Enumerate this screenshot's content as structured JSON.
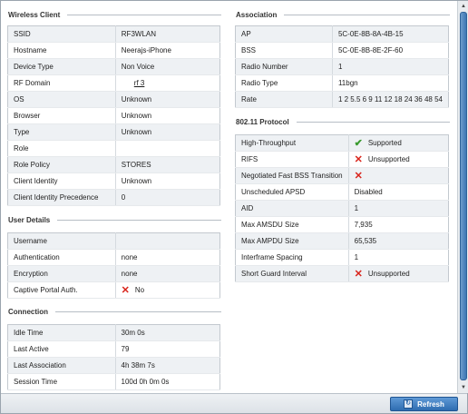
{
  "wireless_client": {
    "title": "Wireless Client",
    "rows": [
      {
        "k": "SSID",
        "v": "RF3WLAN"
      },
      {
        "k": "Hostname",
        "v": "Neerajs-iPhone"
      },
      {
        "k": "Device Type",
        "v": "Non Voice"
      },
      {
        "k": "RF Domain",
        "v": "rf 3",
        "link": true
      },
      {
        "k": "OS",
        "v": "Unknown"
      },
      {
        "k": "Browser",
        "v": "Unknown"
      },
      {
        "k": "Type",
        "v": "Unknown"
      },
      {
        "k": "Role",
        "v": ""
      },
      {
        "k": "Role Policy",
        "v": "STORES"
      },
      {
        "k": "Client Identity",
        "v": "Unknown"
      },
      {
        "k": "Client Identity Precedence",
        "v": "0"
      }
    ]
  },
  "user_details": {
    "title": "User Details",
    "rows": [
      {
        "k": "Username",
        "v": ""
      },
      {
        "k": "Authentication",
        "v": "none"
      },
      {
        "k": "Encryption",
        "v": "none"
      },
      {
        "k": "Captive Portal Auth.",
        "v": "No",
        "icon": "x-icon"
      }
    ]
  },
  "connection": {
    "title": "Connection",
    "rows": [
      {
        "k": "Idle Time",
        "v": "30m 0s"
      },
      {
        "k": "Last Active",
        "v": "79"
      },
      {
        "k": "Last Association",
        "v": "4h 38m 7s"
      },
      {
        "k": "Session Time",
        "v": "100d 0h 0m 0s"
      }
    ]
  },
  "association": {
    "title": "Association",
    "rows": [
      {
        "k": "AP",
        "v": "5C-0E-8B-8A-4B-15"
      },
      {
        "k": "BSS",
        "v": "5C-0E-8B-8E-2F-60"
      },
      {
        "k": "Radio Number",
        "v": "1"
      },
      {
        "k": "Radio Type",
        "v": "11bgn"
      },
      {
        "k": "Rate",
        "v": "1 2 5.5 6 9 11 12 18 24 36 48 54"
      }
    ]
  },
  "protocol": {
    "title": "802.11 Protocol",
    "rows": [
      {
        "k": "High-Throughput",
        "v": "Supported",
        "icon": "check-icon"
      },
      {
        "k": "RIFS",
        "v": "Unsupported",
        "icon": "x-icon"
      },
      {
        "k": "Negotiated Fast BSS Transition",
        "v": "",
        "icon": "x-icon"
      },
      {
        "k": "Unscheduled APSD",
        "v": "Disabled"
      },
      {
        "k": "AID",
        "v": "1"
      },
      {
        "k": "Max AMSDU Size",
        "v": "7,935"
      },
      {
        "k": "Max AMPDU Size",
        "v": "65,535"
      },
      {
        "k": "Interframe Spacing",
        "v": "1"
      },
      {
        "k": "Short Guard Interval",
        "v": "Unsupported",
        "icon": "x-icon"
      }
    ]
  },
  "footer": {
    "refresh_label": "Refresh"
  },
  "colors": {
    "accent": "#2e6cb0",
    "error": "#d9241b",
    "success": "#3a9a2e"
  }
}
